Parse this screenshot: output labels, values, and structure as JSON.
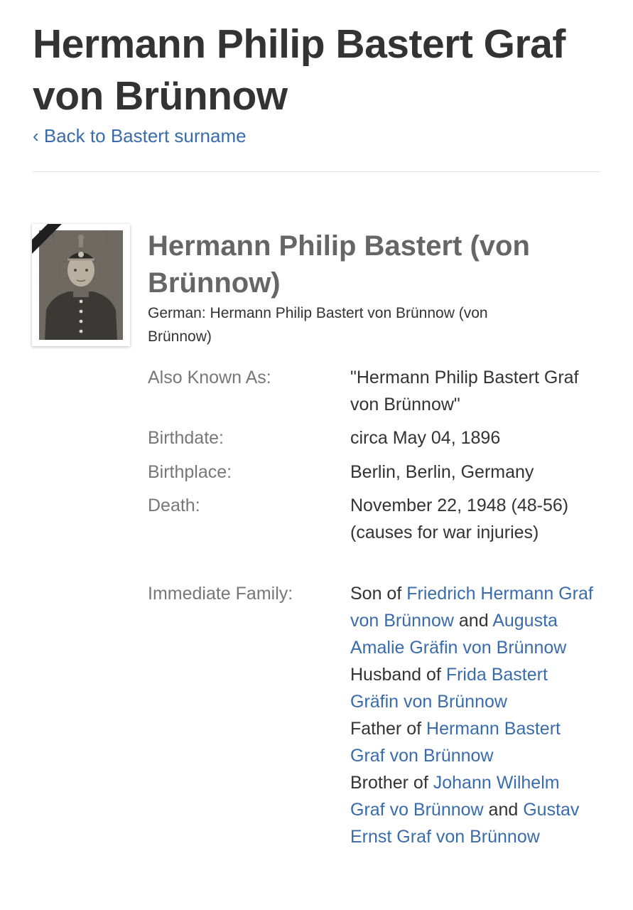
{
  "header": {
    "title": "Hermann Philip Bastert Graf von Brünnow",
    "back_link": "‹ Back to Bastert surname"
  },
  "profile": {
    "name": "Hermann Philip Bastert (von Brünnow)",
    "native_name": "German: Hermann Philip Bastert von Brünnow (von Brünnow)",
    "photo_icon": "portrait-photo",
    "ribbon_color": "#1e1e1e"
  },
  "facts": {
    "aka_label": "Also Known As:",
    "aka_value": "\"Hermann Philip Bastert Graf von Brünnow\"",
    "birthdate_label": "Birthdate:",
    "birthdate_value": "circa May 04, 1896",
    "birthplace_label": "Birthplace:",
    "birthplace_value": "Berlin, Berlin, Germany",
    "death_label": "Death:",
    "death_value": "November 22, 1948 (48-56) (causes for war injuries)",
    "family_label": "Immediate Family:"
  },
  "family": {
    "son_of": "Son of",
    "father": "Friedrich Hermann Graf von Brünnow",
    "and_1": "and",
    "mother": "Augusta Amalie Gräfin von Brünnow",
    "husband_of": "Husband of",
    "wife": "Frida Bastert Gräfin von Brünnow",
    "father_of": "Father of",
    "child": "Hermann Bastert Graf von Brünnow",
    "brother_of": "Brother of",
    "brother_1": "Johann Wilhelm Graf vo Brünnow",
    "and_2": "and",
    "brother_2": "Gustav Ernst Graf von Brünnow"
  },
  "colors": {
    "link": "#3a6cab",
    "title": "#333333",
    "label": "#777777"
  }
}
